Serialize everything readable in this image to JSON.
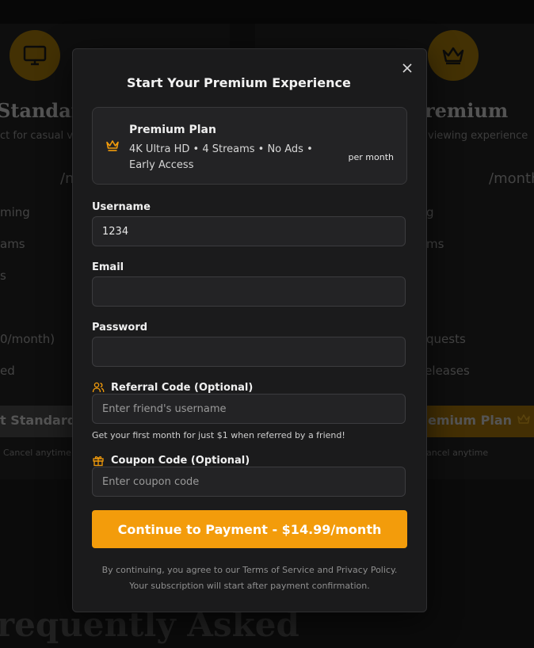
{
  "background": {
    "standard": {
      "title": "Standard",
      "subtitle": "ct for casual vie",
      "per": "/m",
      "features": [
        "ming",
        "ams",
        "s",
        "",
        "0/month)",
        "ed"
      ],
      "button": "t Standard",
      "cancel": "Cancel anytime"
    },
    "premium": {
      "title": "remium",
      "subtitle": "viewing experience",
      "per": "/month",
      "features": [
        "g",
        "ms",
        "",
        "",
        "quests",
        "leleases"
      ],
      "button": "emium Plan",
      "cancel": "ancel anytime"
    },
    "faq_heading": "requently Asked"
  },
  "modal": {
    "title": "Start Your Premium Experience",
    "close_icon": "close-icon",
    "plan": {
      "icon": "crown-icon",
      "name": "Premium Plan",
      "description": "4K Ultra HD • 4 Streams • No Ads • Early Access",
      "price_suffix": "per month"
    },
    "fields": {
      "username": {
        "label": "Username",
        "value": "1234",
        "placeholder": ""
      },
      "email": {
        "label": "Email",
        "value": "",
        "placeholder": ""
      },
      "password": {
        "label": "Password",
        "value": "",
        "placeholder": ""
      },
      "referral": {
        "label": "Referral Code (Optional)",
        "icon": "users-icon",
        "value": "",
        "placeholder": "Enter friend's username"
      },
      "coupon": {
        "label": "Coupon Code (Optional)",
        "icon": "gift-icon",
        "value": "",
        "placeholder": "Enter coupon code"
      }
    },
    "referral_hint": "Get your first month for just $1 when referred by a friend!",
    "pay_button": "Continue to Payment - $14.99/month",
    "terms": "By continuing, you agree to our Terms of Service and Privacy Policy. Your subscription will start after payment confirmation."
  },
  "colors": {
    "accent": "#f39c0b",
    "modal_bg": "#1b1b1c",
    "field_bg": "#232325"
  }
}
